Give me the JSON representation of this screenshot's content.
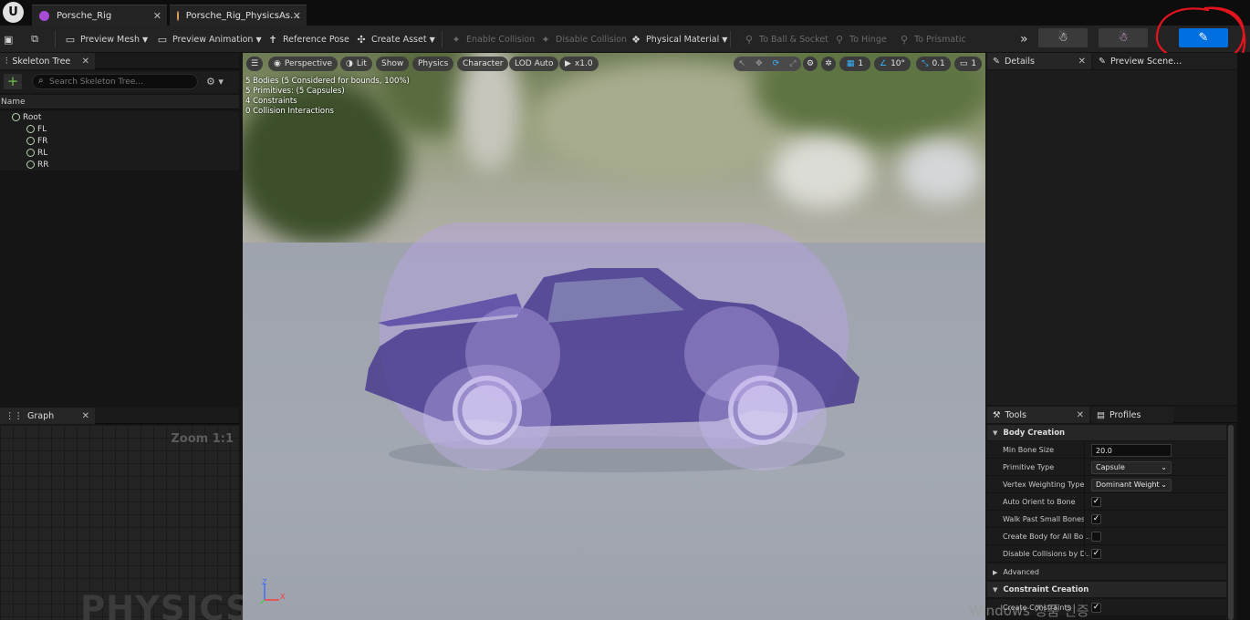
{
  "tabs": [
    {
      "label": "Porsche_Rig",
      "icon": "mesh-icon",
      "color": "#a84bd6"
    },
    {
      "label": "Porsche_Rig_PhysicsAs…",
      "icon": "physics-asset-icon",
      "color": "#e8a45a"
    }
  ],
  "toolbar": {
    "preview_mesh": "Preview Mesh",
    "preview_animation": "Preview Animation",
    "reference_pose": "Reference Pose",
    "create_asset": "Create Asset",
    "enable_collision": "Enable Collision",
    "disable_collision": "Disable Collision",
    "physical_material": "Physical Material",
    "to_ball_socket": "To Ball & Socket",
    "to_hinge": "To Hinge",
    "to_prismatic": "To Prismatic",
    "more": "»"
  },
  "skeleton_tree": {
    "tab_label": "Skeleton Tree",
    "search_placeholder": "Search Skeleton Tree...",
    "column_name": "Name",
    "bones": [
      {
        "name": "Root",
        "level": 0
      },
      {
        "name": "FL",
        "level": 1
      },
      {
        "name": "FR",
        "level": 1
      },
      {
        "name": "RL",
        "level": 1
      },
      {
        "name": "RR",
        "level": 1
      }
    ]
  },
  "graph": {
    "tab_label": "Graph",
    "zoom": "Zoom 1:1",
    "watermark": "PHYSICS"
  },
  "viewport": {
    "perspective": "Perspective",
    "lit": "Lit",
    "show": "Show",
    "physics": "Physics",
    "character": "Character",
    "lod": "LOD Auto",
    "speed": "x1.0",
    "grid_value": "1",
    "angle_value": "10°",
    "scale_value": "0.1",
    "camera_value": "1",
    "stats": [
      "5 Bodies (5 Considered for bounds, 100%)",
      "5 Primitives: (5 Capsules)",
      "4 Constraints",
      "0 Collision Interactions"
    ],
    "axis_z": "Z",
    "axis_x": "X"
  },
  "details": {
    "tab_label": "Details",
    "preview_tab_label": "Preview Scene…"
  },
  "tools": {
    "tab_label": "Tools",
    "profiles_label": "Profiles",
    "body_creation": "Body Creation",
    "constraint_creation": "Constraint Creation",
    "advanced": "Advanced",
    "props": [
      {
        "label": "Min Bone Size",
        "type": "input",
        "value": "20.0"
      },
      {
        "label": "Primitive Type",
        "type": "combo",
        "value": "Capsule"
      },
      {
        "label": "Vertex Weighting Type",
        "type": "combo",
        "value": "Dominant Weight"
      },
      {
        "label": "Auto Orient to Bone",
        "type": "check",
        "value": "✓"
      },
      {
        "label": "Walk Past Small Bones",
        "type": "check",
        "value": "✓"
      },
      {
        "label": "Create Body for All Bo…",
        "type": "check",
        "value": ""
      },
      {
        "label": "Disable Collisions by D…",
        "type": "check",
        "value": "✓"
      }
    ],
    "create_constraints_label": "Create Constraints",
    "create_constraints_value": "✓"
  },
  "windows_watermark": "Windows 정품 인증",
  "colors": {
    "accent_blue": "#0070e0",
    "annotation_red": "#e3141e",
    "ragdoll_purple": "#7a5bc8"
  }
}
